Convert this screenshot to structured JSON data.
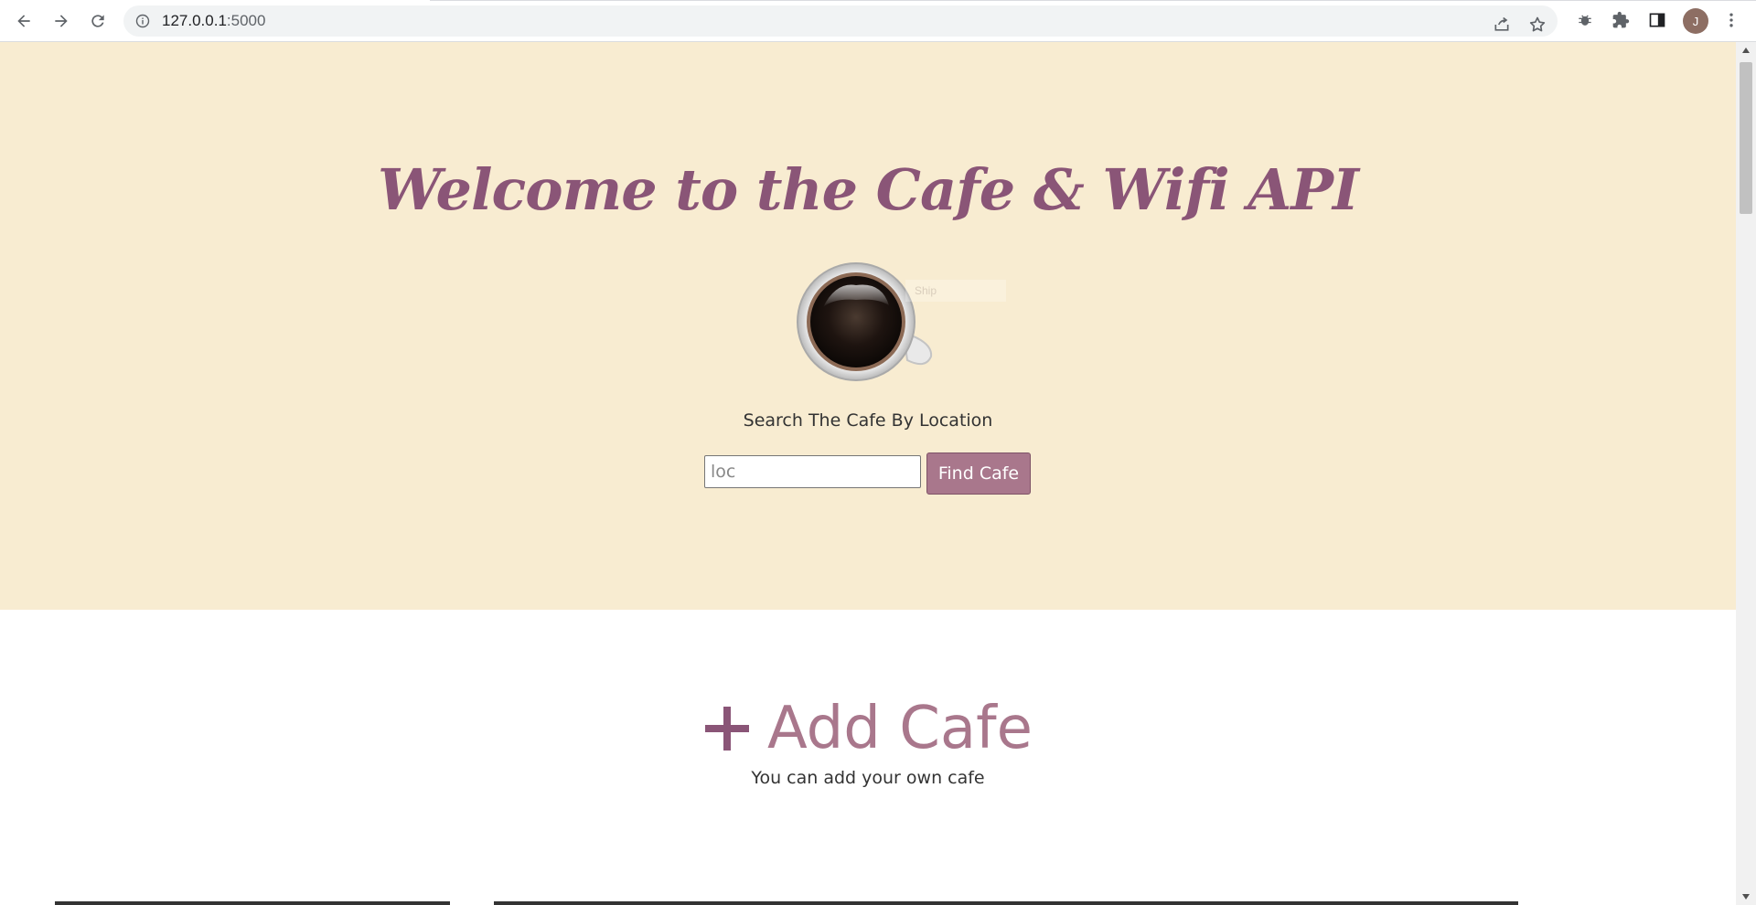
{
  "browser": {
    "url_host": "127.0.0.1",
    "url_port": ":5000",
    "profile_initial": "J",
    "icons": {
      "back": "arrow-left-icon",
      "forward": "arrow-right-icon",
      "reload": "reload-icon",
      "site_info": "info-icon",
      "share": "share-icon",
      "bookmark": "star-icon",
      "extension_bug": "bug-icon",
      "extensions": "puzzle-icon",
      "side_panel": "side-panel-icon",
      "menu": "kebab-menu-icon"
    }
  },
  "hero": {
    "title": "Welcome to the Cafe & Wifi API",
    "image_alt_ghost": "Ship",
    "search_label": "Search The Cafe By Location",
    "search_input": {
      "value": "",
      "placeholder": "loc"
    },
    "find_button": "Find Cafe"
  },
  "add_section": {
    "title": "Add Cafe",
    "subtitle": "You can add your own cafe",
    "icon": "plus-icon"
  },
  "colors": {
    "hero_bg": "#f8ecd1",
    "title": "#8a5577",
    "accent": "#a9778c"
  }
}
